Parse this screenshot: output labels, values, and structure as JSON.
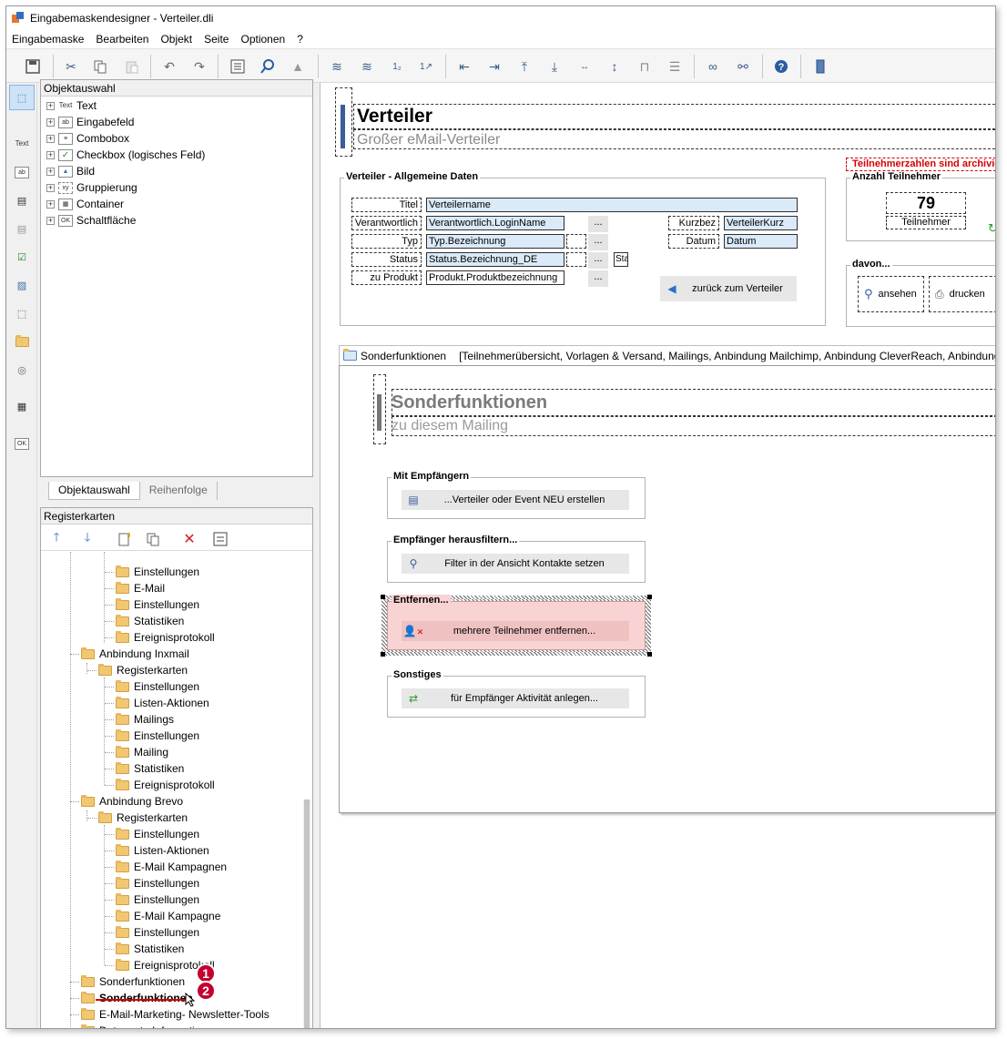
{
  "window": {
    "title": "Eingabemaskendesigner - Verteiler.dli"
  },
  "menu": [
    "Eingabemaske",
    "Bearbeiten",
    "Objekt",
    "Seite",
    "Optionen",
    "?"
  ],
  "toolbar_icons": [
    "save-icon",
    "cut-icon",
    "copy-icon",
    "paste-icon",
    "undo-icon",
    "redo-icon",
    "properties-icon",
    "search-icon",
    "warning-icon",
    "layer-up-icon",
    "layer-down-icon",
    "numbering-icon",
    "tab-order-icon",
    "align-left-icon",
    "align-right-icon",
    "align-top-icon",
    "align-bottom-icon",
    "same-width-icon",
    "same-height-icon",
    "space-horizontal-icon",
    "space-vertical-icon",
    "link-icon",
    "unlink-icon",
    "help-icon",
    "bookmark-icon"
  ],
  "left_tools": {
    "text_label": "Text",
    "ok_label": "OK"
  },
  "objektauswahl": {
    "header": "Objektauswahl",
    "items": [
      {
        "icon": "text-icon",
        "icon_text": "Text",
        "label": "Text"
      },
      {
        "icon": "input-field-icon",
        "icon_text": "ab",
        "label": "Eingabefeld"
      },
      {
        "icon": "combobox-icon",
        "icon_text": "≡",
        "label": "Combobox"
      },
      {
        "icon": "checkbox-icon",
        "icon_text": "✓",
        "label": "Checkbox (logisches Feld)"
      },
      {
        "icon": "image-icon",
        "icon_text": "▲",
        "label": "Bild"
      },
      {
        "icon": "group-icon",
        "icon_text": "xy",
        "label": "Gruppierung"
      },
      {
        "icon": "container-icon",
        "icon_text": "▦",
        "label": "Container"
      },
      {
        "icon": "button-icon",
        "icon_text": "OK",
        "label": "Schaltfläche"
      }
    ],
    "tabs": [
      "Objektauswahl",
      "Reihenfolge"
    ]
  },
  "registerkarten": {
    "header": "Registerkarten",
    "tree": [
      {
        "label": "Einstellungen",
        "level": 3
      },
      {
        "label": "E-Mail",
        "level": 3
      },
      {
        "label": "Einstellungen",
        "level": 3
      },
      {
        "label": "Statistiken",
        "level": 3
      },
      {
        "label": "Ereignisprotokoll",
        "level": 3
      },
      {
        "label": "Anbindung Inxmail",
        "level": 1
      },
      {
        "label": "Registerkarten",
        "level": 2
      },
      {
        "label": "Einstellungen",
        "level": 3
      },
      {
        "label": "Listen-Aktionen",
        "level": 3
      },
      {
        "label": "Mailings",
        "level": 3
      },
      {
        "label": "Einstellungen",
        "level": 3
      },
      {
        "label": "Mailing",
        "level": 3
      },
      {
        "label": "Statistiken",
        "level": 3
      },
      {
        "label": "Ereignisprotokoll",
        "level": 3
      },
      {
        "label": "Anbindung Brevo",
        "level": 1
      },
      {
        "label": "Registerkarten",
        "level": 2
      },
      {
        "label": "Einstellungen",
        "level": 3
      },
      {
        "label": "Listen-Aktionen",
        "level": 3
      },
      {
        "label": "E-Mail Kampagnen",
        "level": 3
      },
      {
        "label": "Einstellungen",
        "level": 3
      },
      {
        "label": "Einstellungen",
        "level": 3
      },
      {
        "label": "E-Mail Kampagne",
        "level": 3
      },
      {
        "label": "Einstellungen",
        "level": 3
      },
      {
        "label": "Statistiken",
        "level": 3
      },
      {
        "label": "Ereignisprotokoll",
        "level": 3
      },
      {
        "label": "Sonderfunktionen",
        "level": 1
      },
      {
        "label": "Sonderfunktionen",
        "level": 1,
        "bold": true
      },
      {
        "label": "E-Mail-Marketing- Newsletter-Tools",
        "level": 1
      },
      {
        "label": "Datensatz-Informationen",
        "level": 1
      }
    ],
    "badges": [
      "1",
      "2"
    ]
  },
  "form": {
    "title": "Verteiler",
    "subtitle": "Großer eMail-Verteiler",
    "general": {
      "group_title": "Verteiler - Allgemeine Daten",
      "labels": {
        "titel": "Titel",
        "verantwortlich": "Verantwortlich",
        "typ": "Typ",
        "status": "Status",
        "produkt": "zu Produkt",
        "kurzbez": "Kurzbez",
        "datum": "Datum"
      },
      "values": {
        "titel": "Verteilername",
        "verantwortlich": "Verantwortlich.LoginName",
        "typ": "Typ.Bezeichnung",
        "status": "Status.Bezeichnung_DE",
        "produkt": "Produkt.Produktbezeichnung",
        "kurzbez": "VerteilerKurz",
        "datum": "Datum",
        "status_extra": "Sta"
      },
      "ellipsis": "...",
      "back_button": "zurück zum Verteiler"
    },
    "participants": {
      "warning": "Teilnehmerzahlen sind archivie",
      "group_title": "Anzahl Teilnehmer",
      "count": "79",
      "count_label": "Teilnehmer"
    },
    "davon": {
      "group_title": "davon...",
      "view_button": "ansehen",
      "print_button": "drucken"
    },
    "tab_strip": {
      "active": "Sonderfunktionen",
      "rest": "[Teilnehmerübersicht, Vorlagen & Versand, Mailings, Anbindung Mailchimp, Anbindung CleverReach, Anbindung"
    },
    "special": {
      "title": "Sonderfunktionen",
      "subtitle": "zu diesem Mailing",
      "groups": [
        {
          "title": "Mit Empfängern",
          "button": "...Verteiler oder Event NEU erstellen",
          "icon": "new-list-icon"
        },
        {
          "title": "Empfänger herausfiltern...",
          "button": "Filter in der Ansicht Kontakte setzen",
          "icon": "filter-icon"
        },
        {
          "title": "Entfernen...",
          "button": "mehrere Teilnehmer entfernen...",
          "icon": "remove-user-icon"
        },
        {
          "title": "Sonstiges",
          "button": "für Empfänger Aktivität anlegen...",
          "icon": "exchange-icon"
        }
      ]
    }
  },
  "colors": {
    "accent_bar": "#3a5d9a",
    "warning": "#d40000",
    "selected_group": "#f9d3d3"
  }
}
